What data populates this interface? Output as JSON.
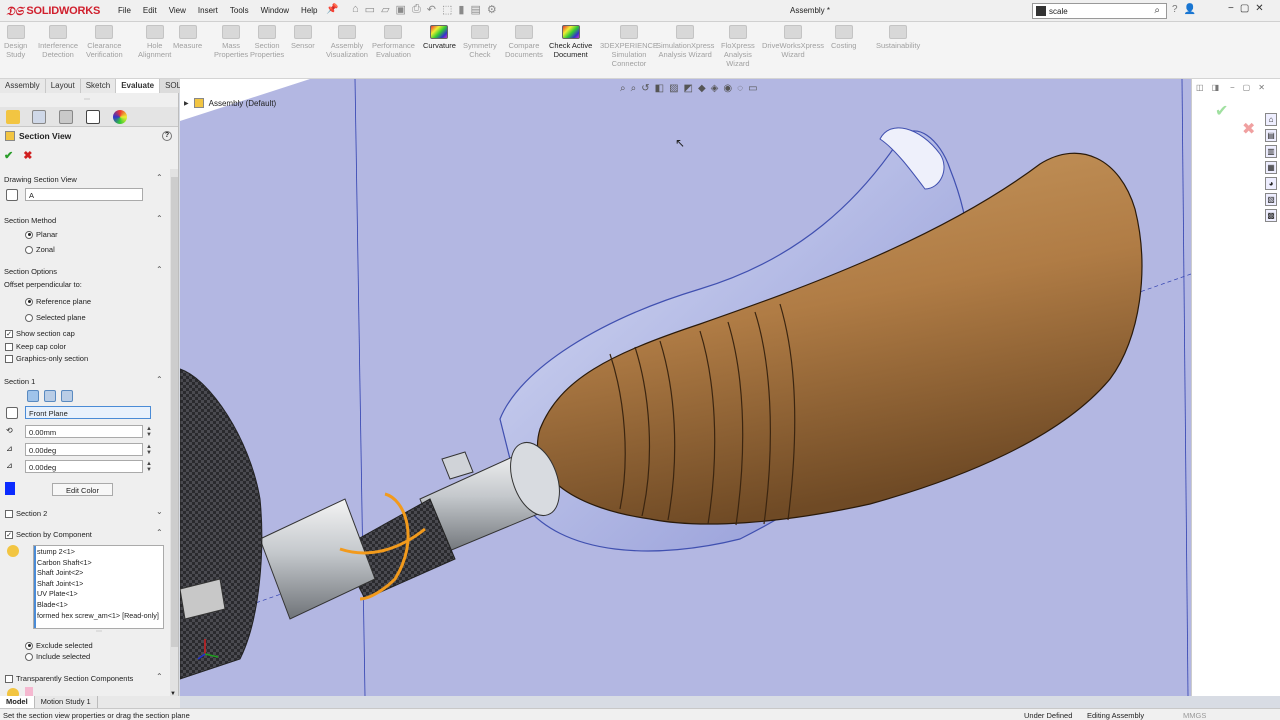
{
  "app": {
    "brand": "SOLIDWORKS",
    "doc_title": "Assembly *"
  },
  "menu": [
    "File",
    "Edit",
    "View",
    "Insert",
    "Tools",
    "Window",
    "Help"
  ],
  "search": {
    "value": "scale"
  },
  "ribbon": [
    {
      "label": "Design\nStudy",
      "active": false
    },
    {
      "label": "Interference\nDetection",
      "active": false
    },
    {
      "label": "Clearance\nVerification",
      "active": false
    },
    {
      "label": "Hole\nAlignment",
      "active": false
    },
    {
      "label": "Measure",
      "active": false
    },
    {
      "label": "Mass\nProperties",
      "active": false
    },
    {
      "label": "Section\nProperties",
      "active": false
    },
    {
      "label": "Sensor",
      "active": false
    },
    {
      "label": "Assembly\nVisualization",
      "active": false
    },
    {
      "label": "Performance\nEvaluation",
      "active": false
    },
    {
      "label": "Curvature",
      "active": true
    },
    {
      "label": "Symmetry\nCheck",
      "active": false
    },
    {
      "label": "Compare\nDocuments",
      "active": false
    },
    {
      "label": "Check Active\nDocument",
      "active": true
    },
    {
      "label": "3DEXPERIENCE\nSimulation\nConnector",
      "active": false
    },
    {
      "label": "SimulationXpress\nAnalysis Wizard",
      "active": false
    },
    {
      "label": "FloXpress\nAnalysis\nWizard",
      "active": false
    },
    {
      "label": "DriveWorksXpress\nWizard",
      "active": false
    },
    {
      "label": "Costing",
      "active": false
    },
    {
      "label": "Sustainability",
      "active": false
    }
  ],
  "tabs": [
    {
      "label": "Assembly",
      "selected": false
    },
    {
      "label": "Layout",
      "selected": false
    },
    {
      "label": "Sketch",
      "selected": false
    },
    {
      "label": "Evaluate",
      "selected": true
    },
    {
      "label": "SOLIDWORKS Add-Ins",
      "selected": false
    },
    {
      "label": "SOLIDWORKS Visualize",
      "selected": false
    }
  ],
  "panel": {
    "title": "Section View",
    "help": "?",
    "drawing_section_view": {
      "header": "Drawing Section View",
      "value": "A"
    },
    "section_method": {
      "header": "Section Method",
      "options": [
        "Planar",
        "Zonal"
      ],
      "selected": "Planar"
    },
    "section_options": {
      "header": "Section Options",
      "offset_label": "Offset perpendicular to:",
      "offset_options": [
        "Reference plane",
        "Selected plane"
      ],
      "offset_selected": "Reference plane",
      "checkboxes": [
        {
          "label": "Show section cap",
          "checked": true
        },
        {
          "label": "Keep cap color",
          "checked": false
        },
        {
          "label": "Graphics-only section",
          "checked": false
        }
      ]
    },
    "section1": {
      "header": "Section 1",
      "plane": "Front Plane",
      "offset": "0.00mm",
      "angle_x": "0.00deg",
      "angle_y": "0.00deg",
      "cap_color": "#0b2bff",
      "edit_color": "Edit Color"
    },
    "section2": {
      "header": "Section 2"
    },
    "section_by_component": {
      "header": "Section by Component",
      "items": [
        "stump 2<1>",
        "Carbon Shaft<1>",
        "Shaft Joint<2>",
        "Shaft Joint<1>",
        "UV Plate<1>",
        "Blade<1>",
        "formed hex screw_am<1> [Read-only]"
      ],
      "options": [
        "Exclude selected",
        "Include selected"
      ],
      "selected": "Exclude selected"
    },
    "transparently": {
      "header": "Transparently Section Components"
    }
  },
  "tree": {
    "root": "Assembly (Default)"
  },
  "bottom_tabs": [
    {
      "label": "Model",
      "selected": true
    },
    {
      "label": "Motion Study 1",
      "selected": false
    }
  ],
  "status": {
    "message": "Set the section view properties or drag the section plane",
    "definition": "Under Defined",
    "mode": "Editing Assembly",
    "units": "MMGS"
  },
  "colors": {
    "viewport_bg": "#b3b7e2",
    "accent": "#4a8bd6",
    "brand": "#d0202e"
  }
}
